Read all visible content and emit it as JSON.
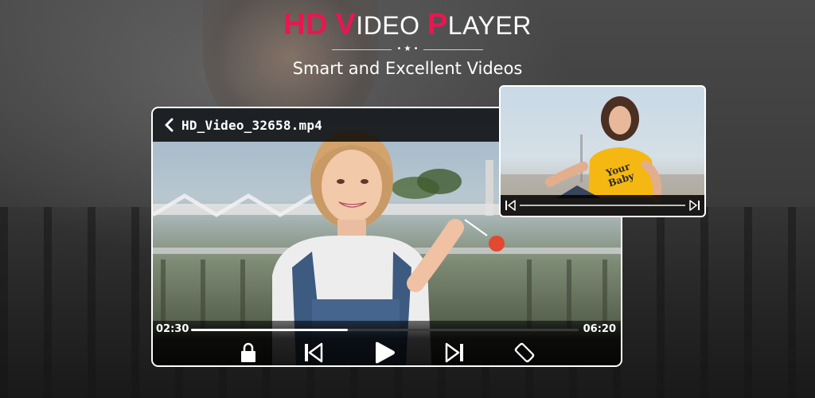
{
  "headline": {
    "title_word1_initial": "HD",
    "title_word2_initial": "V",
    "title_word2_rest": "IDEO",
    "title_word3_initial": "P",
    "title_word3_rest": "LAYER",
    "subtitle": "Smart and Excellent Videos"
  },
  "player": {
    "file_name": "HD_Video_32658.mp4",
    "current_time": "02:30",
    "duration": "06:20",
    "progress": 0.405
  },
  "pip": {
    "shirt_line1": "Your",
    "shirt_line2": "Baby"
  },
  "colors": {
    "accent": "#e8174f",
    "text": "#ffffff",
    "bar": "#000000"
  }
}
